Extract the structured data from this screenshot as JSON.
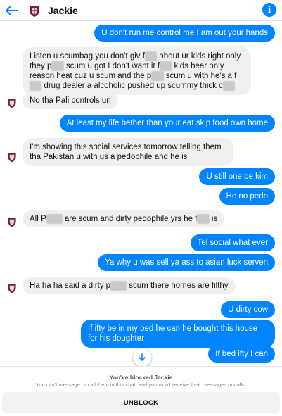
{
  "header": {
    "contact_name": "Jackie",
    "back_icon": "arrow-left-icon",
    "info_icon": "info-icon",
    "accent": "#0084ff"
  },
  "messages": [
    {
      "dir": "out",
      "text": "U don't run me control  me I am out  your hands"
    },
    {
      "dir": "in",
      "segments": [
        "Listen u scumbag you don't giv f",
        "about ur kids right only they",
        "p",
        "scum u got I don't want it f",
        "kids hear only reason heat cuz u scum and the p",
        "scum u with he's a f",
        "drug dealer a alcoholic pushed up scummy thick c"
      ]
    },
    {
      "dir": "in",
      "text": "No tha Pali controls un"
    },
    {
      "dir": "out",
      "text": "At least  my life bether than your eat skip food own home"
    },
    {
      "dir": "in",
      "text": "I'm showing this social services tomorrow telling them tha Pakistan u with us a pedophile and he is"
    },
    {
      "dir": "out",
      "text": "U still one be kim"
    },
    {
      "dir": "out",
      "text": "He no pedo"
    },
    {
      "dir": "in",
      "segments": [
        "All P",
        "are scum and dirty pedophile yrs he f",
        "is"
      ]
    },
    {
      "dir": "out",
      "text": "Tel social what  ever"
    },
    {
      "dir": "out",
      "text": "Ya why u was sell ya ass to asian luck serven"
    },
    {
      "dir": "in",
      "segments": [
        "Ha ha ha said a dirty p",
        "scum there homes are filthy"
      ]
    },
    {
      "dir": "out",
      "text": "U dirty cow"
    },
    {
      "dir": "out",
      "text": "If ifty be in my bed he can he bought this house for his doughter"
    },
    {
      "dir": "out",
      "text": "If bed ifty I can"
    }
  ],
  "scroll_icon": "arrow-down-icon",
  "blocked": {
    "title": "You've blocked Jackie",
    "description": "You can't message or call them in this chat, and you won't receive their messages or calls.",
    "unblock_label": "UNBLOCK"
  }
}
